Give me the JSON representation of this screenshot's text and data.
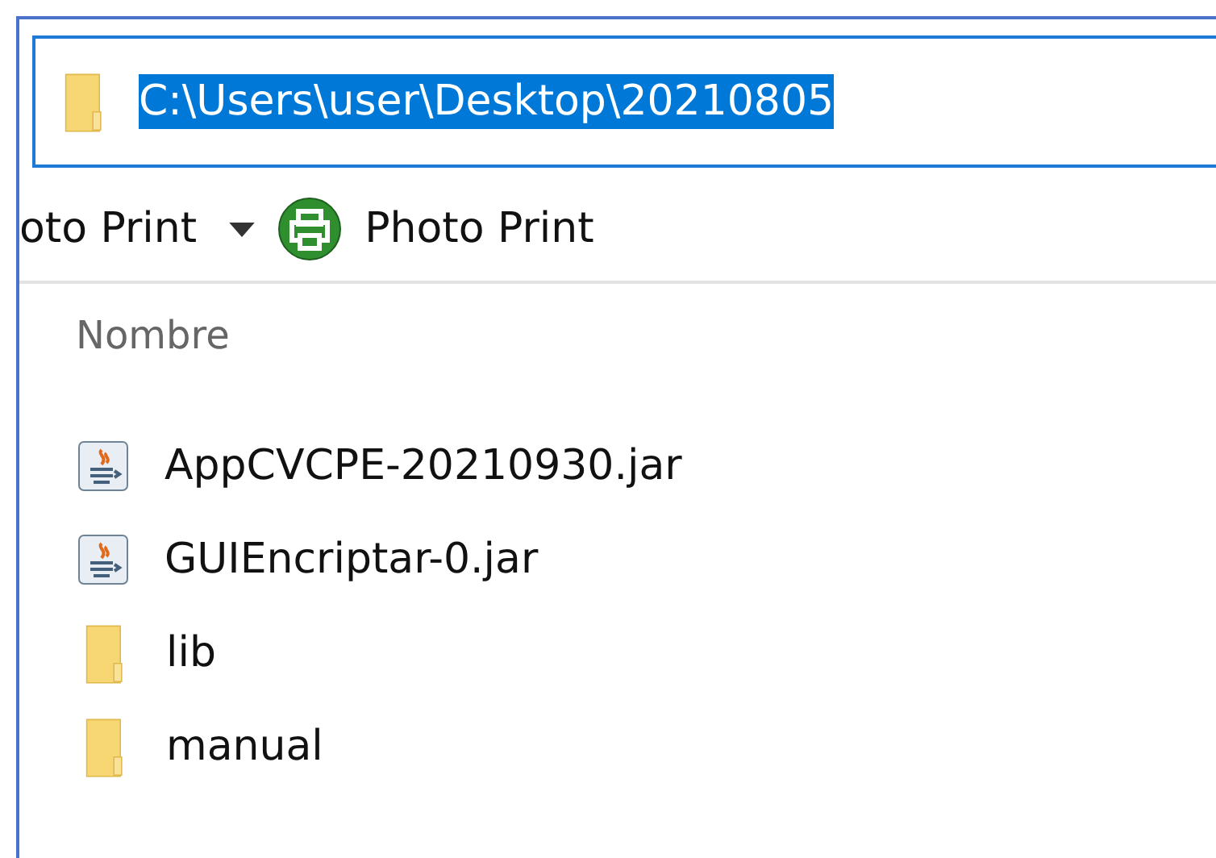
{
  "address_bar": {
    "value": "C:\\Users\\user\\Desktop\\20210805",
    "selected": true
  },
  "toolbar": {
    "items": [
      {
        "label": "oto Print",
        "kind": "dropdown"
      },
      {
        "label": "Photo Print",
        "kind": "print"
      }
    ]
  },
  "file_list": {
    "column": "Nombre",
    "items": [
      {
        "name": "AppCVCPE-20210930.jar",
        "kind": "jar"
      },
      {
        "name": "GUIEncriptar-0.jar",
        "kind": "jar"
      },
      {
        "name": "lib",
        "kind": "folder"
      },
      {
        "name": "manual",
        "kind": "folder"
      }
    ]
  }
}
